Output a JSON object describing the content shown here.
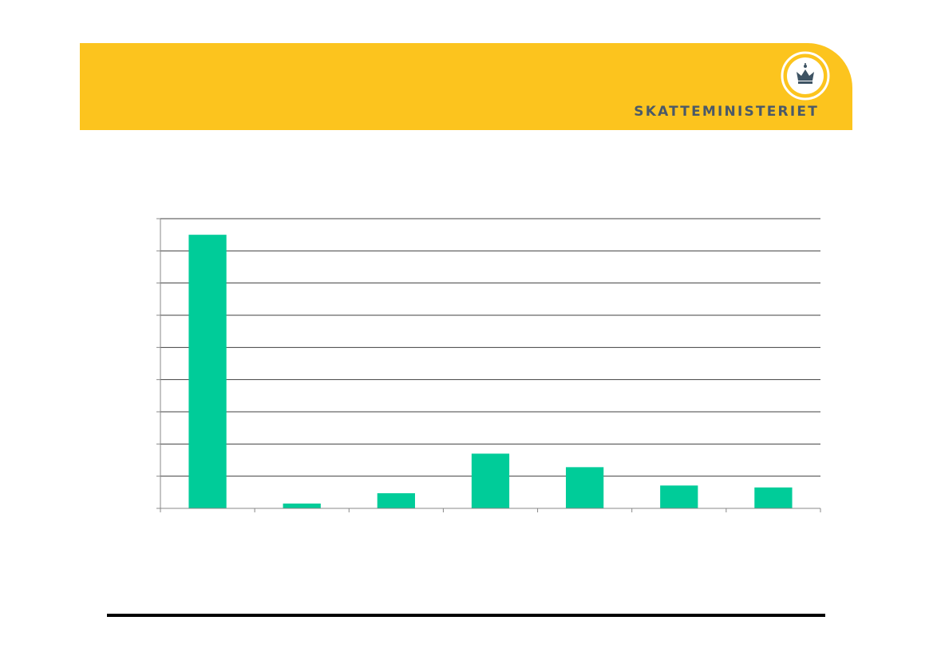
{
  "header": {
    "brand": "SKATTEMINISTERIET",
    "logo_icon": "crown-emblem-icon"
  },
  "colors": {
    "brand": "#FCC41E",
    "wordmark": "#4A5968",
    "bar": "#00CC99",
    "gridline": "#404040",
    "axis": "#888888",
    "footer_rule": "#000000"
  },
  "chart_data": {
    "type": "bar",
    "categories": [
      "",
      "",
      "",
      "",
      "",
      "",
      ""
    ],
    "values": [
      85,
      1.5,
      4.7,
      17,
      12.8,
      7.1,
      6.5
    ],
    "ylim": [
      0,
      90
    ],
    "grid": true,
    "title": "",
    "xlabel": "",
    "ylabel": ""
  }
}
